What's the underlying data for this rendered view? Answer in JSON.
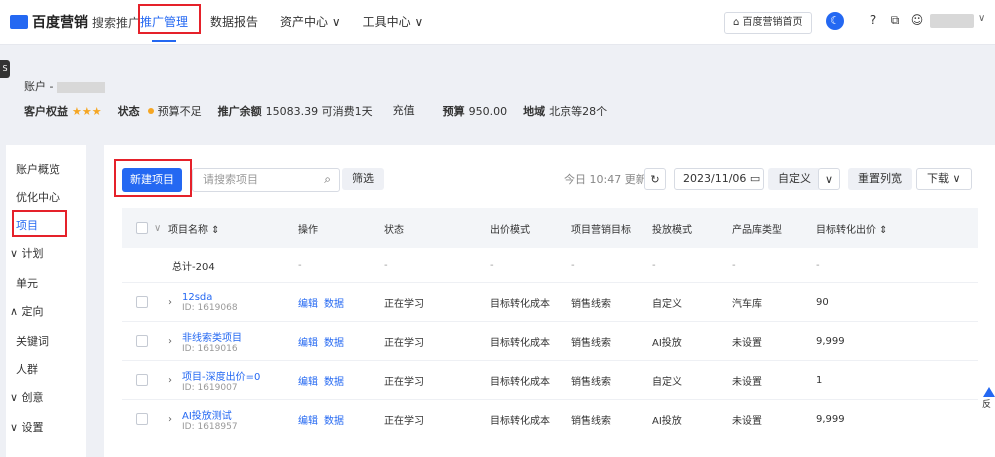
{
  "brand": {
    "name": "百度营销",
    "product": "搜索推广"
  },
  "nav": [
    {
      "label": "推广管理",
      "active": true
    },
    {
      "label": "数据报告"
    },
    {
      "label": "资产中心 ∨"
    },
    {
      "label": "工具中心 ∨"
    }
  ],
  "header": {
    "home_label": "百度营销首页",
    "moon_icon": "☾",
    "help_icon": "?",
    "link_icon": "⧉",
    "user_icon": "☺"
  },
  "side_tab": "S",
  "account": {
    "title": "账户 -",
    "rights_label": "客户权益",
    "stars": "★★★",
    "status_label": "状态",
    "status_value": "预算不足",
    "balance_label": "推广余额",
    "balance_value": "15083.39 可消费1天",
    "recharge": "充值",
    "budget_label": "预算",
    "budget_value": "950.00",
    "region_label": "地域",
    "region_value": "北京等28个"
  },
  "sidebar": [
    {
      "label": "账户概览"
    },
    {
      "label": "优化中心"
    },
    {
      "label": "项目",
      "active": true
    },
    {
      "label": "∨ 计划"
    },
    {
      "label": "单元"
    },
    {
      "label": "∧ 定向"
    },
    {
      "label": "关键词"
    },
    {
      "label": "人群"
    },
    {
      "label": "∨ 创意"
    },
    {
      "label": "∨ 设置"
    }
  ],
  "toolbar": {
    "new_project": "新建项目",
    "search_placeholder": "请搜索项目",
    "filter": "筛选",
    "update": "今日 10:47 更新",
    "refresh_icon": "↻",
    "date": "2023/11/06 ▭",
    "custom": "自定义",
    "caret": "∨",
    "reset_cols": "重置列宽",
    "download": "下载 ∨"
  },
  "table": {
    "headers": [
      "项目名称 ⇕",
      "操作",
      "状态",
      "出价模式",
      "项目营销目标",
      "投放模式",
      "产品库类型",
      "目标转化出价 ⇕"
    ],
    "total": {
      "name": "总计-204",
      "dash": "-"
    },
    "rows": [
      {
        "name": "12sda",
        "id": "ID: 1619068",
        "ops": [
          "编辑",
          "数据"
        ],
        "status": "正在学习",
        "bid": "目标转化成本",
        "goal": "销售线索",
        "mode": "自定义",
        "lib": "汽车库",
        "price": "90"
      },
      {
        "name": "非线索类项目",
        "id": "ID: 1619016",
        "ops": [
          "编辑",
          "数据"
        ],
        "status": "正在学习",
        "bid": "目标转化成本",
        "goal": "销售线索",
        "mode": "AI投放",
        "lib": "未设置",
        "price": "9,999"
      },
      {
        "name": "项目-深度出价=0",
        "id": "ID: 1619007",
        "ops": [
          "编辑",
          "数据"
        ],
        "status": "正在学习",
        "bid": "目标转化成本",
        "goal": "销售线索",
        "mode": "自定义",
        "lib": "未设置",
        "price": "1"
      },
      {
        "name": "AI投放测试",
        "id": "ID: 1618957",
        "ops": [
          "编辑",
          "数据"
        ],
        "status": "正在学习",
        "bid": "目标转化成本",
        "goal": "销售线索",
        "mode": "AI投放",
        "lib": "未设置",
        "price": "9,999"
      }
    ]
  },
  "fab": "反"
}
